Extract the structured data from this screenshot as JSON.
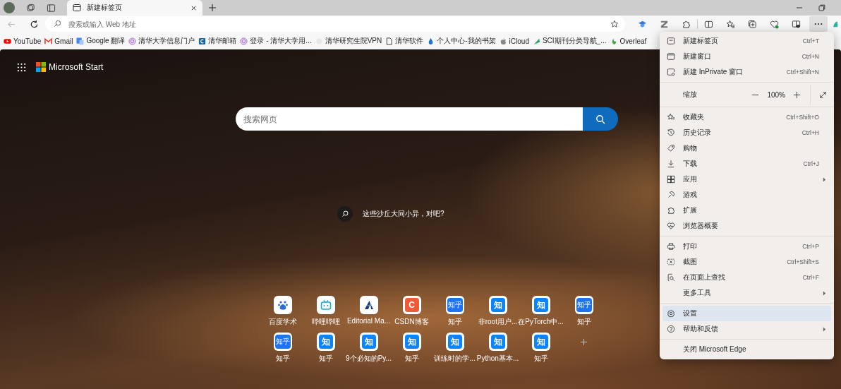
{
  "tabs": [
    {
      "title": "新建标签页",
      "selected": true
    }
  ],
  "address_bar": {
    "placeholder": "搜索或输入 Web 地址"
  },
  "navigation": {
    "back_disabled": true
  },
  "bookmarks": [
    {
      "label": "YouTube"
    },
    {
      "label": "Gmail"
    },
    {
      "label": "Google 翻译"
    },
    {
      "label": "清华大学信息门户"
    },
    {
      "label": "清华邮箱"
    },
    {
      "label": "登录 - 清华大学用..."
    },
    {
      "label": "清华研究生院VPN"
    },
    {
      "label": "清华软件"
    },
    {
      "label": "个人中心-我的书架"
    },
    {
      "label": "iCloud"
    },
    {
      "label": "SCI期刊分类导航_..."
    },
    {
      "label": "Overleaf"
    }
  ],
  "new_tab_page": {
    "brand": "Microsoft Start",
    "search": {
      "placeholder": "搜索网页"
    },
    "image_caption": "这些沙丘大同小异，对吧?",
    "quick_links": [
      {
        "label": "百度学术",
        "kind": "baidu"
      },
      {
        "label": "哔哩哔哩",
        "kind": "bilibili"
      },
      {
        "label": "Editorial Ma...",
        "kind": "editorial"
      },
      {
        "label": "CSDN博客",
        "kind": "letter",
        "glyph": "C",
        "color": "#f05a38"
      },
      {
        "label": "知乎",
        "kind": "letter",
        "glyph": "知乎",
        "color": "#1e73f0"
      },
      {
        "label": "非root用户...",
        "kind": "letter",
        "glyph": "知",
        "color": "#0a84ff"
      },
      {
        "label": "在PyTorch中...",
        "kind": "letter",
        "glyph": "知",
        "color": "#0a84ff"
      },
      {
        "label": "知乎",
        "kind": "letter",
        "glyph": "知乎",
        "color": "#1e73f0"
      },
      {
        "label": "知乎",
        "kind": "letter",
        "glyph": "知乎",
        "color": "#1e73f0"
      },
      {
        "label": "知乎",
        "kind": "letter",
        "glyph": "知",
        "color": "#0a84ff"
      },
      {
        "label": "9个必知的Py...",
        "kind": "letter",
        "glyph": "知",
        "color": "#0a84ff"
      },
      {
        "label": "知乎",
        "kind": "letter",
        "glyph": "知",
        "color": "#0a84ff"
      },
      {
        "label": "训练时的学...",
        "kind": "letter",
        "glyph": "知",
        "color": "#0a84ff"
      },
      {
        "label": "Python基本...",
        "kind": "letter",
        "glyph": "知",
        "color": "#0a84ff"
      },
      {
        "label": "知乎",
        "kind": "letter",
        "glyph": "知",
        "color": "#0a84ff"
      },
      {
        "kind": "add"
      }
    ]
  },
  "menu": {
    "open": true,
    "sections": [
      [
        {
          "label": "新建标签页",
          "shortcut": "Ctrl+T",
          "submenu": false,
          "selected": false
        },
        {
          "label": "新建窗口",
          "shortcut": "Ctrl+N",
          "submenu": false,
          "selected": false
        },
        {
          "label": "新建 InPrivate 窗口",
          "shortcut": "Ctrl+Shift+N",
          "submenu": false,
          "selected": false
        }
      ],
      [
        {
          "label": "缩放",
          "kind": "zoom",
          "value": "100%"
        }
      ],
      [
        {
          "label": "收藏夹",
          "shortcut": "Ctrl+Shift+O",
          "submenu": false,
          "selected": false
        },
        {
          "label": "历史记录",
          "shortcut": "Ctrl+H",
          "submenu": false,
          "selected": false
        },
        {
          "label": "购物",
          "submenu": false,
          "selected": false
        },
        {
          "label": "下载",
          "shortcut": "Ctrl+J",
          "submenu": false,
          "selected": false
        },
        {
          "label": "应用",
          "submenu": true,
          "selected": false
        },
        {
          "label": "游戏",
          "submenu": false,
          "selected": false
        },
        {
          "label": "扩展",
          "submenu": false,
          "selected": false
        },
        {
          "label": "浏览器概要",
          "submenu": false,
          "selected": false
        }
      ],
      [
        {
          "label": "打印",
          "shortcut": "Ctrl+P",
          "submenu": false,
          "selected": false
        },
        {
          "label": "截图",
          "shortcut": "Ctrl+Shift+S",
          "submenu": false,
          "selected": false
        },
        {
          "label": "在页面上查找",
          "shortcut": "Ctrl+F",
          "submenu": false,
          "selected": false
        },
        {
          "label": "更多工具",
          "submenu": true,
          "selected": false
        }
      ],
      [
        {
          "label": "设置",
          "submenu": false,
          "selected": true
        },
        {
          "label": "帮助和反馈",
          "submenu": true,
          "selected": false
        }
      ],
      [
        {
          "label": "关闭 Microsoft Edge",
          "submenu": false,
          "selected": false
        }
      ]
    ]
  }
}
